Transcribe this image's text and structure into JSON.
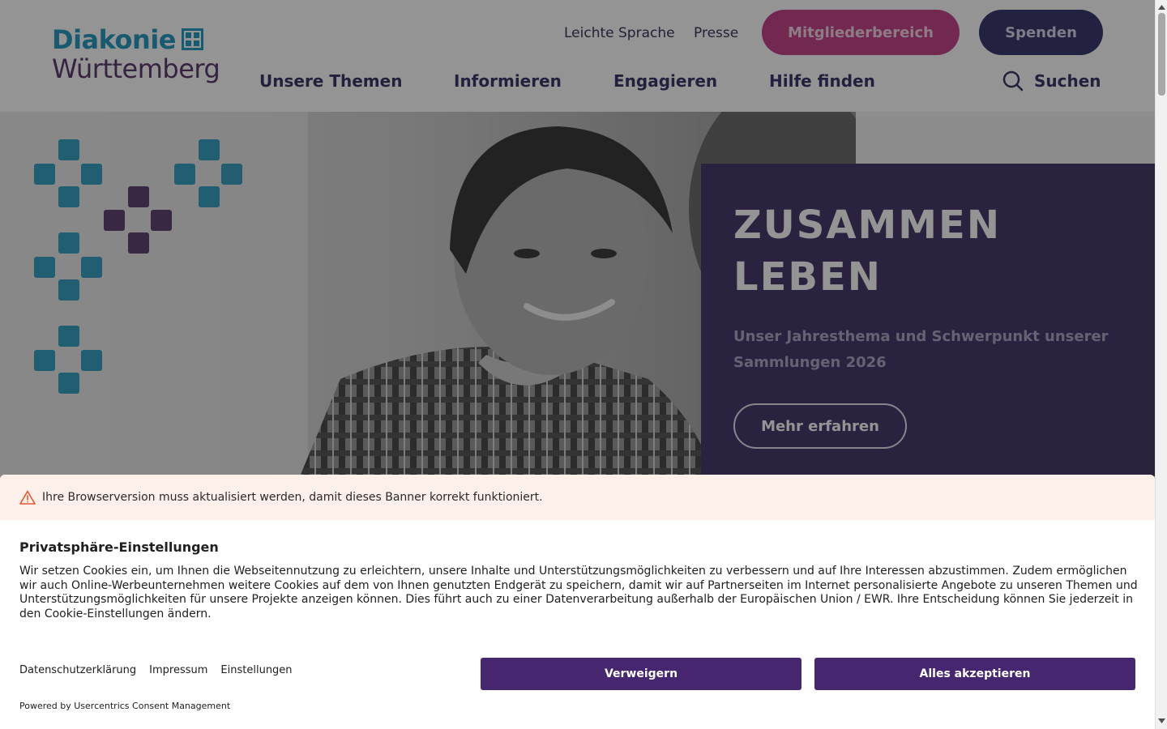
{
  "header": {
    "logo": {
      "line1": "Diakonie",
      "line2": "Württemberg"
    },
    "utility_links": [
      "Leichte Sprache",
      "Presse"
    ],
    "members_button": "Mitgliederbereich",
    "donate_button": "Spenden",
    "nav": [
      "Unsere Themen",
      "Informieren",
      "Engagieren",
      "Hilfe finden"
    ],
    "search_label": "Suchen",
    "icons": {
      "search": "search-icon",
      "logo_mark": "diakonie-cross-icon"
    }
  },
  "hero": {
    "title": "ZUSAMMEN LEBEN",
    "subtitle": "Unser Jahresthema und Schwerpunkt unserer Sammlungen 2026",
    "button": "Mehr erfahren",
    "colors": {
      "panel": "#4a3b6e",
      "pattern_teal": "#2a9bbf",
      "pattern_purple": "#5c3d6e"
    }
  },
  "consent": {
    "warning": "Ihre Browserversion muss aktualisiert werden, damit dieses Banner korrekt funktioniert.",
    "title": "Privatsphäre-Einstellungen",
    "body": "Wir setzen Cookies ein, um Ihnen die Webseitennutzung zu erleichtern, unsere Inhalte und Unterstützungsmöglichkeiten zu verbessern und auf Ihre Interessen abzustimmen. Zudem ermöglichen wir auch Online-Werbeunternehmen weitere Cookies auf dem von Ihnen genutzten Endgerät zu speichern, damit wir auf Partnerseiten im Internet personalisierte Angebote zu unseren Themen und Unterstützungsmöglichkeiten für unsere Projekte anzeigen können. Dies führt auch zu einer Datenverarbeitung außerhalb der Europäischen Union / EWR. Ihre Entscheidung können Sie jederzeit in den Cookie-Einstellungen ändern.",
    "links": [
      "Datenschutzerklärung",
      "Impressum",
      "Einstellungen"
    ],
    "deny_button": "Verweigern",
    "accept_button": "Alles akzeptieren",
    "powered_by": "Powered by Usercentrics Consent Management",
    "colors": {
      "button": "#46266e",
      "warning_bg": "#fdf0ea",
      "warning_icon": "#e4572e"
    }
  }
}
